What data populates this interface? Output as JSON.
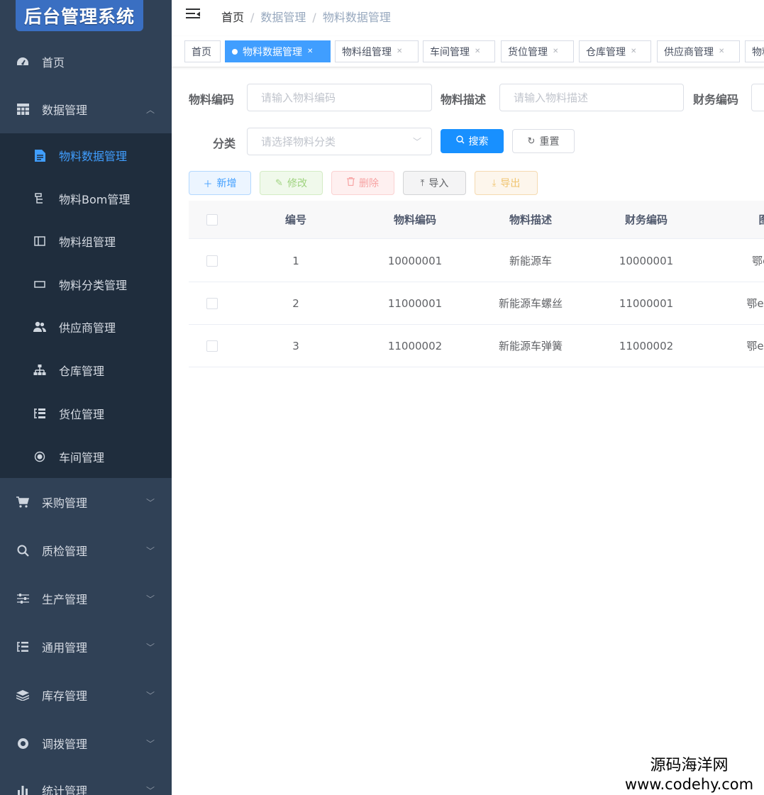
{
  "app": {
    "logo_text": "后台管理系统"
  },
  "sidebar": {
    "top_items": [
      {
        "label": "首页",
        "icon": "dashboard-icon"
      },
      {
        "label": "数据管理",
        "icon": "grid-icon"
      }
    ],
    "data_submenu": [
      {
        "label": "物料数据管理",
        "icon": "document-icon"
      },
      {
        "label": "物料Bom管理",
        "icon": "tree-icon"
      },
      {
        "label": "物料组管理",
        "icon": "columns-icon"
      },
      {
        "label": "物料分类管理",
        "icon": "rectangle-icon"
      },
      {
        "label": "供应商管理",
        "icon": "users-icon"
      },
      {
        "label": "仓库管理",
        "icon": "sitemap-icon"
      },
      {
        "label": "货位管理",
        "icon": "list-icon"
      },
      {
        "label": "车间管理",
        "icon": "radio-icon"
      }
    ],
    "bottom_items": [
      {
        "label": "采购管理",
        "icon": "cart-icon"
      },
      {
        "label": "质检管理",
        "icon": "search-icon"
      },
      {
        "label": "生产管理",
        "icon": "sliders-icon"
      },
      {
        "label": "通用管理",
        "icon": "list-icon"
      },
      {
        "label": "库存管理",
        "icon": "layers-icon"
      },
      {
        "label": "调拨管理",
        "icon": "swap-icon"
      },
      {
        "label": "统计管理",
        "icon": "bar-chart-icon"
      }
    ]
  },
  "breadcrumb": [
    "首页",
    "数据管理",
    "物料数据管理"
  ],
  "tags": [
    "首页",
    "物料数据管理",
    "物料组管理",
    "车间管理",
    "货位管理",
    "仓库管理",
    "供应商管理",
    "物料"
  ],
  "search": {
    "material_code_label": "物料编码",
    "material_code_placeholder": "请输入物料编码",
    "material_desc_label": "物料描述",
    "material_desc_placeholder": "请输入物料描述",
    "finance_code_label": "财务编码",
    "category_label": "分类",
    "category_placeholder": "请选择物料分类",
    "search_button": "搜索",
    "reset_button": "重置"
  },
  "toolbar": {
    "add": "新增",
    "edit": "修改",
    "delete": "删除",
    "import": "导入",
    "export": "导出"
  },
  "table": {
    "columns": [
      "编号",
      "物料编码",
      "物料描述",
      "财务编码",
      "图"
    ],
    "rows": [
      {
        "no": "1",
        "code": "10000001",
        "desc": "新能源车",
        "finance": "10000001",
        "extra": "鄂en"
      },
      {
        "no": "2",
        "code": "11000001",
        "desc": "新能源车螺丝",
        "finance": "11000001",
        "extra": "鄂ener"
      },
      {
        "no": "3",
        "code": "11000002",
        "desc": "新能源车弹簧",
        "finance": "11000002",
        "extra": "鄂ener"
      }
    ]
  },
  "watermark": {
    "line1": "源码海洋网",
    "line2": "www.codehy.com"
  }
}
